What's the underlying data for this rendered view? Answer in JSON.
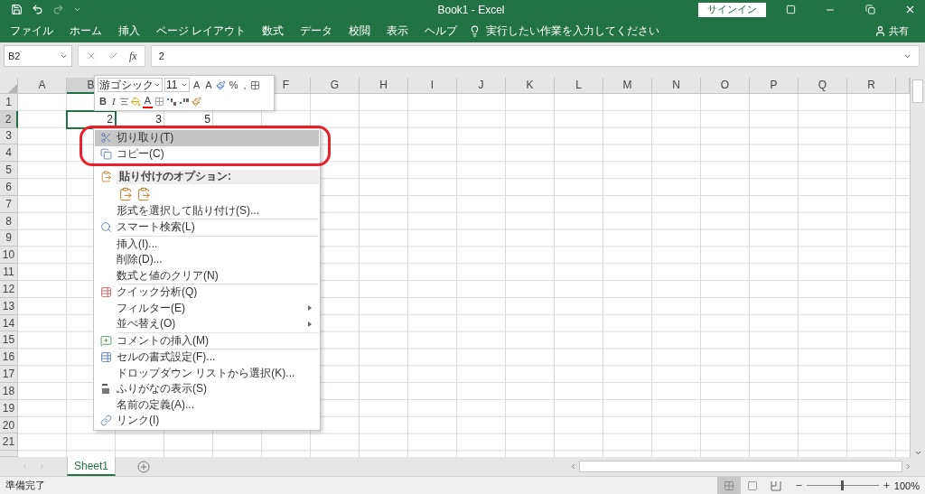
{
  "window": {
    "title": "Book1  -  Excel",
    "sign_in": "サインイン"
  },
  "ribbon": {
    "tabs": [
      {
        "label": "ファイル",
        "selected": false
      },
      {
        "label": "ホーム",
        "selected": false
      },
      {
        "label": "挿入",
        "selected": false
      },
      {
        "label": "ページ レイアウト",
        "selected": false
      },
      {
        "label": "数式",
        "selected": false
      },
      {
        "label": "データ",
        "selected": false
      },
      {
        "label": "校閲",
        "selected": false
      },
      {
        "label": "表示",
        "selected": false
      },
      {
        "label": "ヘルプ",
        "selected": false
      }
    ],
    "tell_me": "実行したい作業を入力してください",
    "share": "共有"
  },
  "formula_bar": {
    "name_box": "B2",
    "fx": "fx",
    "formula": "2"
  },
  "sheet": {
    "columns": [
      {
        "label": "A"
      },
      {
        "label": "B"
      },
      {},
      {},
      {},
      {
        "label": "F"
      },
      {
        "label": "G"
      },
      {
        "label": "H"
      },
      {
        "label": "I"
      },
      {
        "label": "J"
      },
      {
        "label": "K"
      },
      {
        "label": "L"
      },
      {
        "label": "M"
      },
      {
        "label": "N"
      },
      {
        "label": "O"
      },
      {
        "label": "P"
      },
      {
        "label": "Q"
      },
      {
        "label": "R"
      }
    ],
    "rows": [
      {
        "label": "1"
      },
      {
        "label": "2",
        "cells": [
          {
            "selected": false
          },
          {
            "value": "2",
            "selected": true
          },
          {
            "value": "3",
            "selected": false
          },
          {
            "value": "5",
            "selected": false
          }
        ]
      },
      {
        "label": "3"
      },
      {
        "label": "4"
      },
      {
        "label": "5"
      },
      {
        "label": "6"
      },
      {
        "label": "7"
      },
      {
        "label": "8"
      },
      {
        "label": "9"
      },
      {
        "label": "10"
      },
      {
        "label": "11"
      },
      {
        "label": "12"
      },
      {
        "label": "13"
      },
      {
        "label": "14"
      },
      {
        "label": "15"
      },
      {
        "label": "16"
      },
      {
        "label": "17"
      },
      {
        "label": "18"
      },
      {
        "label": "19"
      },
      {
        "label": "20"
      },
      {
        "label": "21"
      }
    ]
  },
  "mini_toolbar": {
    "font": "游ゴシック",
    "size": "11",
    "grow": "A",
    "shrink": "A",
    "percent": "%",
    "comma": ",",
    "bold": "B",
    "italic": "I",
    "font_color": "A"
  },
  "context_menu": {
    "items": [
      {
        "kind": "item",
        "label": "切り取り(T)",
        "highlighted": true,
        "submenu": false
      },
      {
        "kind": "item",
        "label": "コピー(C)",
        "highlighted": false,
        "submenu": false
      },
      {
        "kind": "header",
        "label": "貼り付けのオプション:"
      },
      {
        "kind": "paste-options"
      },
      {
        "kind": "item",
        "label": "形式を選択して貼り付け(S)...",
        "highlighted": false,
        "submenu": false
      },
      {
        "kind": "separator"
      },
      {
        "kind": "item",
        "label": "スマート検索(L)",
        "highlighted": false,
        "submenu": false
      },
      {
        "kind": "separator"
      },
      {
        "kind": "item",
        "label": "挿入(I)...",
        "highlighted": false,
        "submenu": false
      },
      {
        "kind": "item",
        "label": "削除(D)...",
        "highlighted": false,
        "submenu": false
      },
      {
        "kind": "item",
        "label": "数式と値のクリア(N)",
        "highlighted": false,
        "submenu": false
      },
      {
        "kind": "separator"
      },
      {
        "kind": "item",
        "label": "クイック分析(Q)",
        "highlighted": false,
        "submenu": false
      },
      {
        "kind": "item",
        "label": "フィルター(E)",
        "highlighted": false,
        "submenu": true
      },
      {
        "kind": "item",
        "label": "並べ替え(O)",
        "highlighted": false,
        "submenu": true
      },
      {
        "kind": "separator"
      },
      {
        "kind": "item",
        "label": "コメントの挿入(M)",
        "highlighted": false,
        "submenu": false
      },
      {
        "kind": "separator"
      },
      {
        "kind": "item",
        "label": "セルの書式設定(F)...",
        "highlighted": false,
        "submenu": false
      },
      {
        "kind": "item",
        "label": "ドロップダウン リストから選択(K)...",
        "highlighted": false,
        "submenu": false
      },
      {
        "kind": "item",
        "label": "ふりがなの表示(S)",
        "highlighted": false,
        "submenu": false
      },
      {
        "kind": "item",
        "label": "名前の定義(A)...",
        "highlighted": false,
        "submenu": false
      },
      {
        "kind": "item",
        "label": "リンク(I)",
        "highlighted": false,
        "submenu": false
      }
    ]
  },
  "annotation": {
    "kind": "ring"
  },
  "sheet_tabs": [
    {
      "label": "Sheet1",
      "selected": true
    }
  ],
  "status_bar": {
    "text": "準備完了",
    "views": [
      {
        "kind": "normal",
        "selected": true
      },
      {
        "kind": "page-layout",
        "selected": false
      },
      {
        "kind": "page-break",
        "selected": false
      }
    ],
    "zoom": {
      "level": 0.5,
      "reading": "100%"
    }
  }
}
